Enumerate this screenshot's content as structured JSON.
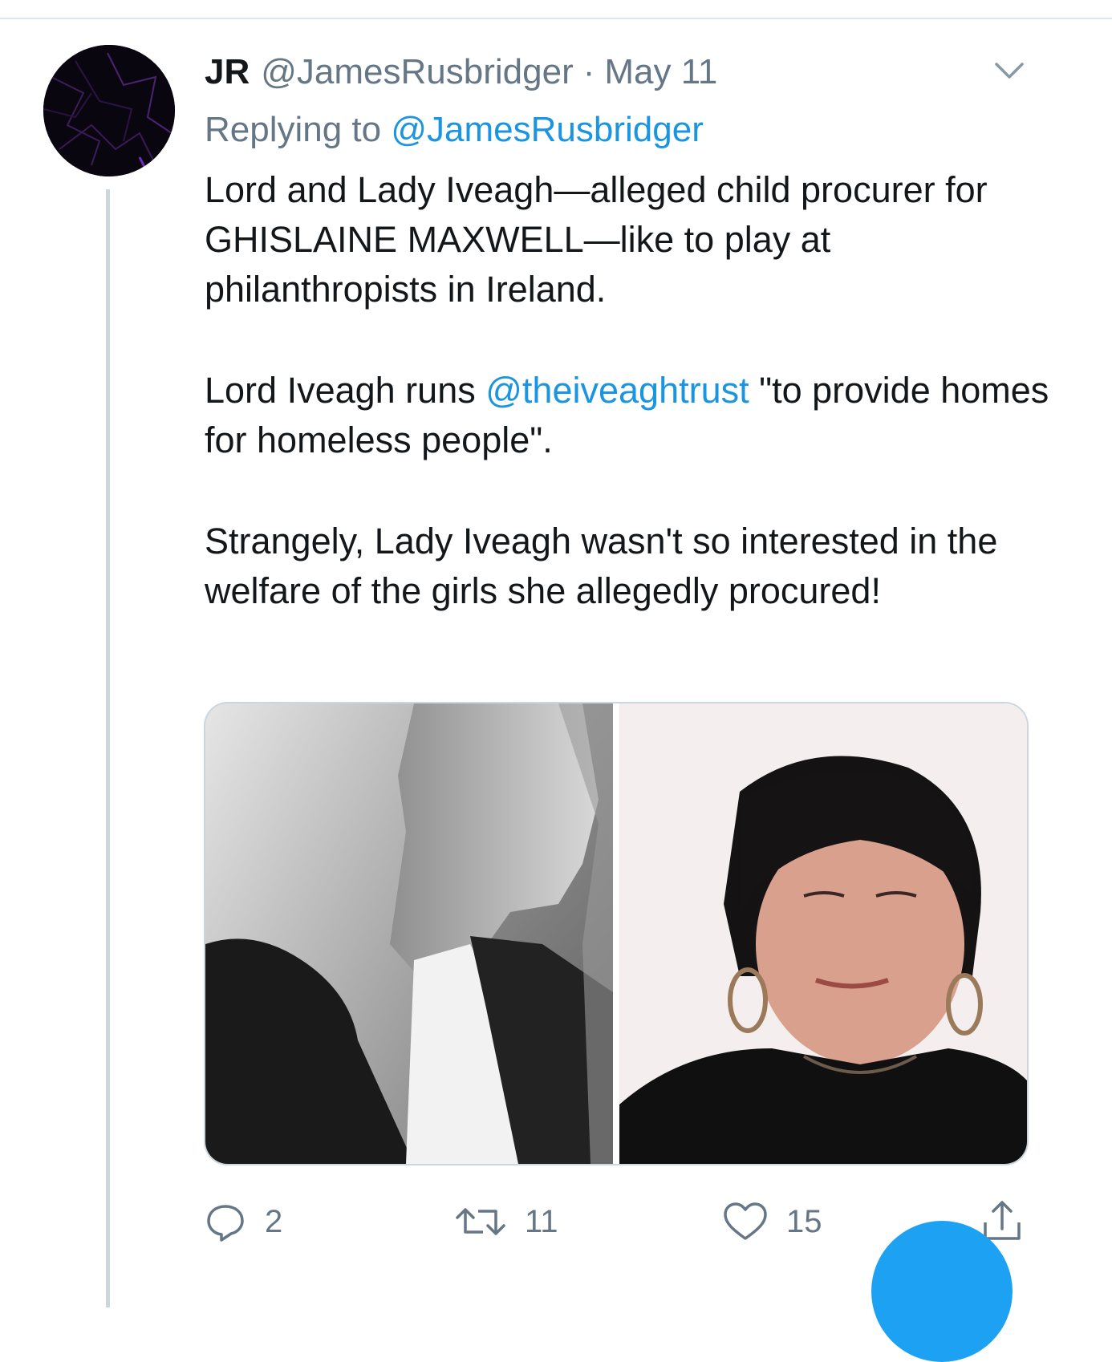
{
  "tweet": {
    "display_name": "JR",
    "handle": "@JamesRusbridger",
    "separator": "·",
    "date": "May 11",
    "replying_prefix": "Replying to",
    "replying_to": "@JamesRusbridger",
    "paragraph_1": "Lord and Lady Iveagh—alleged child procurer for GHISLAINE MAXWELL—like to play at philanthropists in Ireland.",
    "paragraph_2_before": "Lord Iveagh runs",
    "paragraph_2_mention": "@theiveaghtrust",
    "paragraph_2_after": "\"to provide homes for homeless people\".",
    "paragraph_3": "Strangely, Lady Iveagh wasn't so interested in the welfare of the girls she allegedly procured!"
  },
  "actions": {
    "replies": "2",
    "retweets": "11",
    "likes": "15"
  },
  "icons": {
    "menu": "chevron-down-icon",
    "reply": "speech-bubble-icon",
    "retweet": "retweet-arrows-icon",
    "like": "heart-icon",
    "share": "share-upload-icon"
  },
  "colors": {
    "link": "#1b95e0",
    "secondary_text": "#657786",
    "primary_text": "#14171a",
    "divider": "#ccd6dd",
    "fab": "#1da1f2"
  }
}
